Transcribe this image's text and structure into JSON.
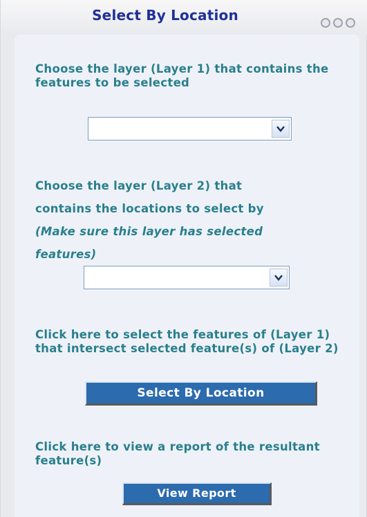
{
  "panel": {
    "title": "Select By Location"
  },
  "step1": {
    "instruction": "Choose the layer (Layer 1) that contains the features to be selected",
    "select_value": ""
  },
  "step2": {
    "instruction_line1": "Choose the layer (Layer 2) that",
    "instruction_line2": "contains the locations to select by",
    "instruction_note_line1": "(Make sure this layer has selected",
    "instruction_note_line2": "features)",
    "select_value": ""
  },
  "step3": {
    "instruction": "Click here to select the features of (Layer 1) that intersect selected feature(s) of (Layer 2)",
    "button_label": "Select By Location"
  },
  "step4": {
    "instruction": "Click here to view a report of the resultant feature(s)",
    "button_label": "View Report"
  },
  "colors": {
    "title": "#1f2f9a",
    "instruction_text": "#2a7f8d",
    "button_bg": "#2c6bad",
    "panel_bg": "#eef2f8",
    "frame_bg": "#e9eaed"
  },
  "icons": {
    "window_controls": "three-circles-icon",
    "dropdown": "chevron-down-icon"
  }
}
